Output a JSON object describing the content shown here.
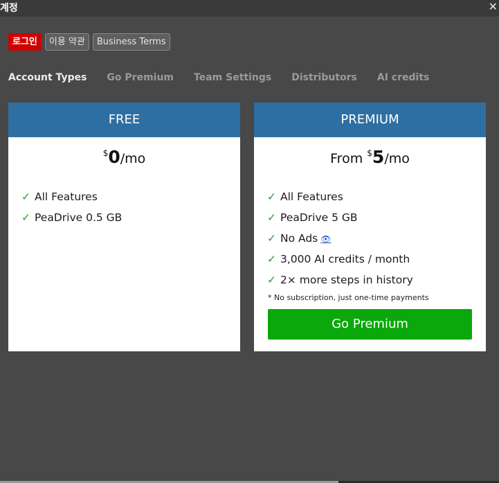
{
  "window": {
    "title": "계정",
    "close_glyph": "✕"
  },
  "buttons": {
    "login": "로그인",
    "terms": "이용 약관",
    "business_terms": "Business Terms"
  },
  "tabs": [
    "Account Types",
    "Go Premium",
    "Team Settings",
    "Distributors",
    "AI credits"
  ],
  "free_plan": {
    "header": "FREE",
    "price_prefix": "",
    "currency": "$",
    "amount": "0",
    "period": "/mo",
    "features": [
      "All Features",
      "PeaDrive 0.5 GB"
    ]
  },
  "premium_plan": {
    "header": "PREMIUM",
    "price_prefix": "From ",
    "currency": "$",
    "amount": "5",
    "period": "/mo",
    "features": [
      "All Features",
      "PeaDrive 5 GB",
      "No Ads",
      "3,000 AI credits / month",
      "2× more steps in history"
    ],
    "note": "* No subscription, just one-time payments",
    "cta": "Go Premium"
  },
  "check_glyph": "✓",
  "eye_glyph": "👁",
  "colors": {
    "background": "#484848",
    "header_blue": "#2e6fa3",
    "cta_green": "#0aa80a",
    "check_green": "#22aa22",
    "login_red": "#d00000"
  }
}
